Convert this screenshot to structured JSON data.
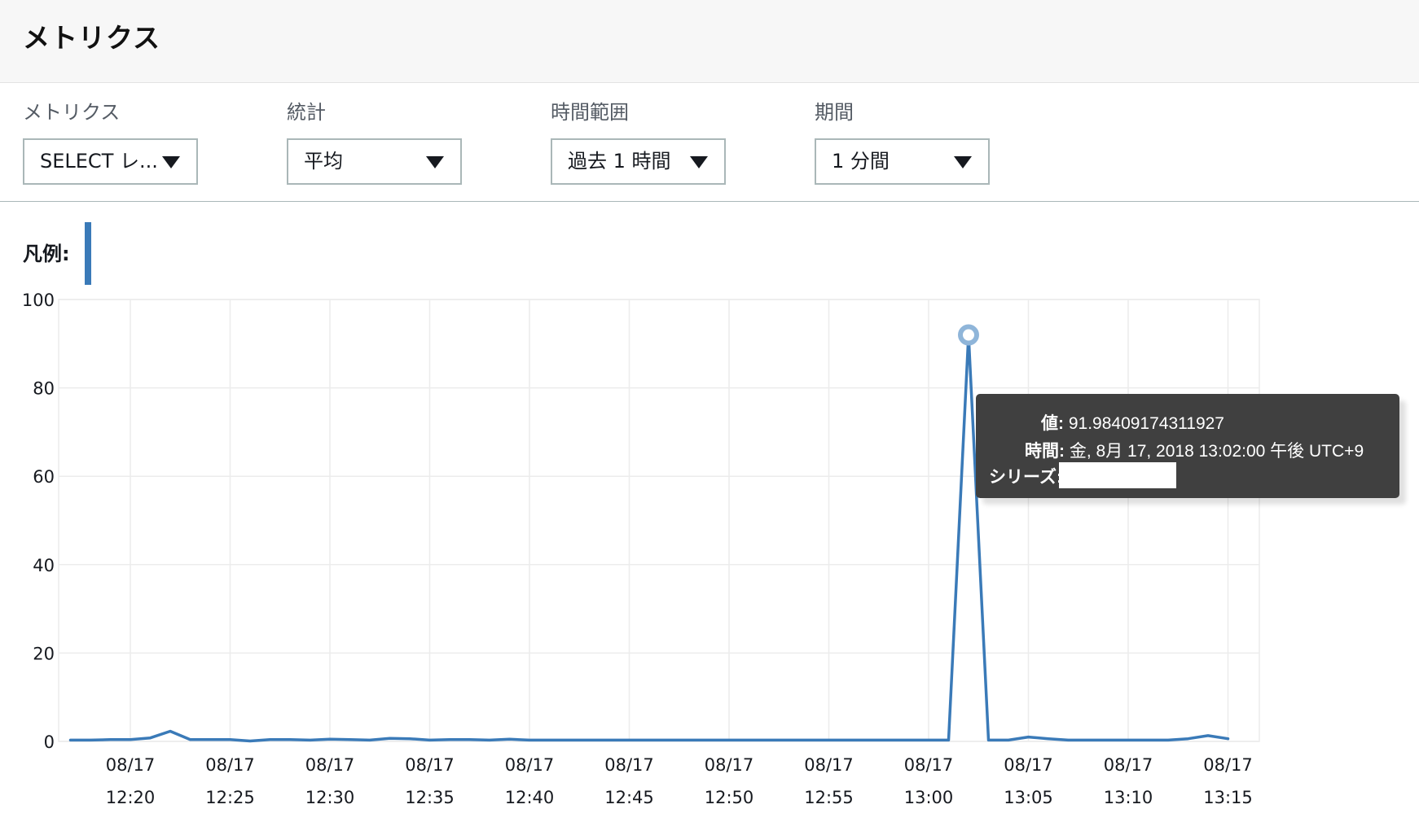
{
  "page_title": "メトリクス",
  "controls": {
    "metric": {
      "label": "メトリクス",
      "value": "SELECT レ..."
    },
    "statistic": {
      "label": "統計",
      "value": "平均"
    },
    "time_range": {
      "label": "時間範囲",
      "value": "過去 1 時間"
    },
    "period": {
      "label": "期間",
      "value": "1 分間"
    }
  },
  "legend": {
    "label": "凡例:",
    "color": "#3a7ab8"
  },
  "tooltip": {
    "value_key": "値:",
    "value": "91.98409174311927",
    "time_key": "時間:",
    "time": "金, 8月 17, 2018 13:02:00 午後 UTC+9",
    "series_key": "シリーズ:"
  },
  "chart_data": {
    "type": "line",
    "xlabel": "",
    "ylabel": "",
    "ylim": [
      0,
      100
    ],
    "yticks": [
      "0",
      "20",
      "40",
      "60",
      "80",
      "100"
    ],
    "x_ticks": [
      {
        "date": "08/17",
        "time": "12:20"
      },
      {
        "date": "08/17",
        "time": "12:25"
      },
      {
        "date": "08/17",
        "time": "12:30"
      },
      {
        "date": "08/17",
        "time": "12:35"
      },
      {
        "date": "08/17",
        "time": "12:40"
      },
      {
        "date": "08/17",
        "time": "12:45"
      },
      {
        "date": "08/17",
        "time": "12:50"
      },
      {
        "date": "08/17",
        "time": "12:55"
      },
      {
        "date": "08/17",
        "time": "13:00"
      },
      {
        "date": "08/17",
        "time": "13:05"
      },
      {
        "date": "08/17",
        "time": "13:10"
      },
      {
        "date": "08/17",
        "time": "13:15"
      }
    ],
    "grid": true,
    "series": [
      {
        "color": "#3a7ab8",
        "x": [
          "12:17",
          "12:18",
          "12:19",
          "12:20",
          "12:21",
          "12:22",
          "12:23",
          "12:24",
          "12:25",
          "12:26",
          "12:27",
          "12:28",
          "12:29",
          "12:30",
          "12:31",
          "12:32",
          "12:33",
          "12:34",
          "12:35",
          "12:36",
          "12:37",
          "12:38",
          "12:39",
          "12:40",
          "12:41",
          "12:42",
          "12:43",
          "12:44",
          "12:45",
          "12:46",
          "12:47",
          "12:48",
          "12:49",
          "12:50",
          "12:51",
          "12:52",
          "12:53",
          "12:54",
          "12:55",
          "12:56",
          "12:57",
          "12:58",
          "12:59",
          "13:00",
          "13:01",
          "13:02",
          "13:03",
          "13:04",
          "13:05",
          "13:06",
          "13:07",
          "13:08",
          "13:09",
          "13:10",
          "13:11",
          "13:12",
          "13:13",
          "13:14",
          "13:15"
        ],
        "values": [
          0.3,
          0.3,
          0.4,
          0.4,
          0.8,
          2.3,
          0.4,
          0.4,
          0.4,
          0.1,
          0.4,
          0.4,
          0.3,
          0.5,
          0.4,
          0.3,
          0.7,
          0.6,
          0.3,
          0.4,
          0.4,
          0.3,
          0.5,
          0.3,
          0.3,
          0.3,
          0.3,
          0.3,
          0.3,
          0.3,
          0.3,
          0.3,
          0.3,
          0.3,
          0.3,
          0.3,
          0.3,
          0.3,
          0.3,
          0.3,
          0.3,
          0.3,
          0.3,
          0.3,
          0.3,
          91.98,
          0.3,
          0.3,
          1.0,
          0.6,
          0.3,
          0.3,
          0.3,
          0.3,
          0.3,
          0.3,
          0.6,
          1.3,
          0.6
        ]
      }
    ],
    "highlight": {
      "x": "13:02",
      "y": 91.98409174311927
    }
  }
}
